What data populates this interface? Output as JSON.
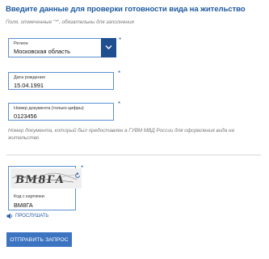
{
  "form": {
    "title": "Введите данные для проверки готовности вида на жительство",
    "required_note": "Поля, отмеченные \"*\", обязательны для заполнения",
    "required_mark": "*",
    "region": {
      "label": "Регион",
      "value": "Московская область"
    },
    "birth_date": {
      "label": "Дата рождения",
      "value": "15.04.1991"
    },
    "document_number": {
      "label": "Номер документа (только цифры)",
      "value": "0123456"
    },
    "document_hint": "Номер документа, который был предоставлен в ГУВМ МВД России для оформления вида на жительство",
    "captcha": {
      "image_text": "ВМ8ГА",
      "label": "Код с картинки",
      "value": "ВМ8ГА",
      "listen_label": "ПРОСЛУШАТЬ"
    },
    "submit_label": "ОТПРАВИТЬ ЗАПРОС"
  },
  "colors": {
    "accent": "#1f5aa0",
    "field_border": "#5a8fd0",
    "select_button": "#1f4f8f",
    "submit_button": "#3c74c2"
  }
}
